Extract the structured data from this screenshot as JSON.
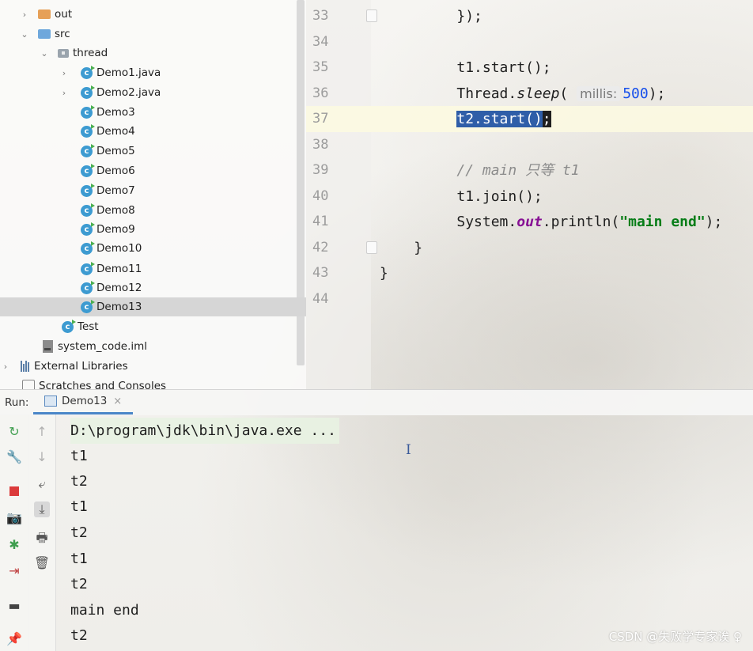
{
  "project_tree": {
    "items": [
      {
        "label": "out",
        "type": "folder-orange",
        "indent": 1,
        "arrow": "›"
      },
      {
        "label": "src",
        "type": "folder-blue",
        "indent": 1,
        "arrow": "⌄"
      },
      {
        "label": "thread",
        "type": "package",
        "indent": 2,
        "arrow": "⌄"
      },
      {
        "label": "Demo1.java",
        "type": "class",
        "indent": 3,
        "arrow": "›"
      },
      {
        "label": "Demo2.java",
        "type": "class",
        "indent": 3,
        "arrow": "›"
      },
      {
        "label": "Demo3",
        "type": "class",
        "indent": 3,
        "arrow": ""
      },
      {
        "label": "Demo4",
        "type": "class",
        "indent": 3,
        "arrow": ""
      },
      {
        "label": "Demo5",
        "type": "class",
        "indent": 3,
        "arrow": ""
      },
      {
        "label": "Demo6",
        "type": "class",
        "indent": 3,
        "arrow": ""
      },
      {
        "label": "Demo7",
        "type": "class",
        "indent": 3,
        "arrow": ""
      },
      {
        "label": "Demo8",
        "type": "class",
        "indent": 3,
        "arrow": ""
      },
      {
        "label": "Demo9",
        "type": "class",
        "indent": 3,
        "arrow": ""
      },
      {
        "label": "Demo10",
        "type": "class",
        "indent": 3,
        "arrow": ""
      },
      {
        "label": "Demo11",
        "type": "class",
        "indent": 3,
        "arrow": ""
      },
      {
        "label": "Demo12",
        "type": "class",
        "indent": 3,
        "arrow": ""
      },
      {
        "label": "Demo13",
        "type": "class",
        "indent": 3,
        "arrow": "",
        "selected": true
      },
      {
        "label": "Test",
        "type": "class",
        "indent": 2,
        "arrow": ""
      },
      {
        "label": "system_code.iml",
        "type": "iml",
        "indent": 1,
        "arrow": ""
      },
      {
        "label": "External Libraries",
        "type": "libraries",
        "indent": 0,
        "arrow": "›"
      },
      {
        "label": "Scratches and Consoles",
        "type": "scratches",
        "indent": 0,
        "arrow": ""
      }
    ]
  },
  "editor": {
    "line_numbers": [
      "33",
      "34",
      "35",
      "36",
      "37",
      "38",
      "39",
      "40",
      "41",
      "42",
      "43",
      "44"
    ],
    "current_line": "37",
    "lines": {
      "l33": "});",
      "l35": "t1.start();",
      "l36_a": "Thread.",
      "l36_b": "sleep",
      "l36_c": "(",
      "l36_hint": "millis:",
      "l36_num": "500",
      "l36_d": ");",
      "l37_sel": "t2.start()",
      "l37_caret": ";",
      "l39": "// main 只等 t1",
      "l40": "t1.join();",
      "l41_a": "System.",
      "l41_b": "out",
      "l41_c": ".println(",
      "l41_str": "\"main end\"",
      "l41_d": ");",
      "l42": "}",
      "l43": "}"
    }
  },
  "run_window": {
    "label": "Run:",
    "tab_label": "Demo13",
    "tab_close": "×",
    "left_tools": [
      "rerun-icon",
      "wrench-icon",
      "stop-icon",
      "camera-icon",
      "debug-bug-icon",
      "login-icon",
      "layout-icon",
      "pin-icon"
    ],
    "console_tools": [
      "up-arrow-icon",
      "down-arrow-icon",
      "soft-wrap-icon",
      "scroll-to-end-icon",
      "print-icon",
      "trash-icon"
    ],
    "console_lines": [
      "D:\\program\\jdk\\bin\\java.exe ...",
      "t1",
      "t2",
      "t1",
      "t2",
      "t1",
      "t2",
      "main end",
      "t2"
    ]
  },
  "watermark": "CSDN @失败学专家诶 ♀"
}
